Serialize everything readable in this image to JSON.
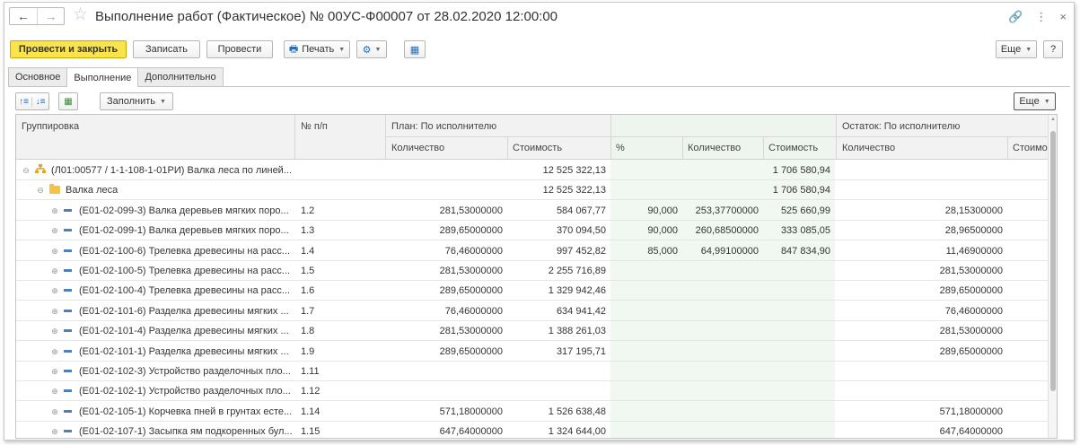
{
  "window": {
    "back": "←",
    "forward": "→",
    "title": "Выполнение работ (Фактическое) № 00УС-Ф00007 от 28.02.2020 12:00:00",
    "link_icon": "🔗",
    "more_icon": "⋮",
    "close_icon": "×"
  },
  "toolbar": {
    "post_close": "Провести и закрыть",
    "save": "Записать",
    "post": "Провести",
    "print": "Печать",
    "more": "Еще",
    "help": "?"
  },
  "tabs": [
    {
      "label": "Основное"
    },
    {
      "label": "Выполнение"
    },
    {
      "label": "Дополнительно"
    }
  ],
  "table_toolbar": {
    "fill": "Заполнить",
    "more": "Еще"
  },
  "grid": {
    "headers": {
      "group": "Группировка",
      "npp": "№ п/п",
      "plan": "План: По исполнителю",
      "rest": "Остаток: По исполнителю",
      "plan_qty": "Количество",
      "plan_cost": "Стоимость",
      "pct": "%",
      "fact_qty": "Количество",
      "fact_cost": "Стоимость",
      "rest_qty": "Количество",
      "rest_cost": "Стоимо"
    },
    "rows": [
      {
        "level": 0,
        "kind": "group",
        "exp": "⊖",
        "name": "(Л01:00577 / 1-1-108-1-01РИ) Валка леса по линей...",
        "npp": "",
        "plan_qty": "",
        "plan_cost": "12 525 322,13",
        "pct": "",
        "fact_qty": "",
        "fact_cost": "1 706 580,94",
        "rest_qty": ""
      },
      {
        "level": 1,
        "kind": "folder",
        "exp": "⊖",
        "name": "Валка леса",
        "npp": "",
        "plan_qty": "",
        "plan_cost": "12 525 322,13",
        "pct": "",
        "fact_qty": "",
        "fact_cost": "1 706 580,94",
        "rest_qty": ""
      },
      {
        "level": 2,
        "kind": "item",
        "exp": "⊕",
        "name": "(Е01-02-099-3) Валка деревьев мягких поро...",
        "npp": "1.2",
        "plan_qty": "281,53000000",
        "plan_cost": "584 067,77",
        "pct": "90,000",
        "fact_qty": "253,37700000",
        "fact_cost": "525 660,99",
        "rest_qty": "28,15300000"
      },
      {
        "level": 2,
        "kind": "item",
        "exp": "⊕",
        "name": "(Е01-02-099-1) Валка деревьев мягких поро...",
        "npp": "1.3",
        "plan_qty": "289,65000000",
        "plan_cost": "370 094,50",
        "pct": "90,000",
        "fact_qty": "260,68500000",
        "fact_cost": "333 085,05",
        "rest_qty": "28,96500000"
      },
      {
        "level": 2,
        "kind": "item",
        "exp": "⊕",
        "name": "(Е01-02-100-6) Трелевка древесины на расс...",
        "npp": "1.4",
        "plan_qty": "76,46000000",
        "plan_cost": "997 452,82",
        "pct": "85,000",
        "fact_qty": "64,99100000",
        "fact_cost": "847 834,90",
        "rest_qty": "11,46900000"
      },
      {
        "level": 2,
        "kind": "item",
        "exp": "⊕",
        "name": "(Е01-02-100-5) Трелевка древесины на расс...",
        "npp": "1.5",
        "plan_qty": "281,53000000",
        "plan_cost": "2 255 716,89",
        "pct": "",
        "fact_qty": "",
        "fact_cost": "",
        "rest_qty": "281,53000000"
      },
      {
        "level": 2,
        "kind": "item",
        "exp": "⊕",
        "name": "(Е01-02-100-4) Трелевка древесины на расс...",
        "npp": "1.6",
        "plan_qty": "289,65000000",
        "plan_cost": "1 329 942,46",
        "pct": "",
        "fact_qty": "",
        "fact_cost": "",
        "rest_qty": "289,65000000"
      },
      {
        "level": 2,
        "kind": "item",
        "exp": "⊕",
        "name": "(Е01-02-101-6) Разделка древесины мягких ...",
        "npp": "1.7",
        "plan_qty": "76,46000000",
        "plan_cost": "634 941,42",
        "pct": "",
        "fact_qty": "",
        "fact_cost": "",
        "rest_qty": "76,46000000"
      },
      {
        "level": 2,
        "kind": "item",
        "exp": "⊕",
        "name": "(Е01-02-101-4) Разделка древесины мягких ...",
        "npp": "1.8",
        "plan_qty": "281,53000000",
        "plan_cost": "1 388 261,03",
        "pct": "",
        "fact_qty": "",
        "fact_cost": "",
        "rest_qty": "281,53000000"
      },
      {
        "level": 2,
        "kind": "item",
        "exp": "⊕",
        "name": "(Е01-02-101-1) Разделка древесины мягких ...",
        "npp": "1.9",
        "plan_qty": "289,65000000",
        "plan_cost": "317 195,71",
        "pct": "",
        "fact_qty": "",
        "fact_cost": "",
        "rest_qty": "289,65000000"
      },
      {
        "level": 2,
        "kind": "item",
        "exp": "⊕",
        "name": "(Е01-02-102-3) Устройство разделочных пло...",
        "npp": "1.11",
        "plan_qty": "",
        "plan_cost": "",
        "pct": "",
        "fact_qty": "",
        "fact_cost": "",
        "rest_qty": ""
      },
      {
        "level": 2,
        "kind": "item",
        "exp": "⊕",
        "name": "(Е01-02-102-1) Устройство разделочных пло...",
        "npp": "1.12",
        "plan_qty": "",
        "plan_cost": "",
        "pct": "",
        "fact_qty": "",
        "fact_cost": "",
        "rest_qty": ""
      },
      {
        "level": 2,
        "kind": "item",
        "exp": "⊕",
        "name": "(Е01-02-105-1) Корчевка пней в грунтах есте...",
        "npp": "1.14",
        "plan_qty": "571,18000000",
        "plan_cost": "1 526 638,48",
        "pct": "",
        "fact_qty": "",
        "fact_cost": "",
        "rest_qty": "571,18000000"
      },
      {
        "level": 2,
        "kind": "item",
        "exp": "⊕",
        "name": "(Е01-02-107-1) Засыпка ям подкоренных бул...",
        "npp": "1.15",
        "plan_qty": "647,64000000",
        "plan_cost": "1 324 644,00",
        "pct": "",
        "fact_qty": "",
        "fact_cost": "",
        "rest_qty": "647,64000000"
      }
    ]
  },
  "colors": {
    "primary_button": "#fbe34b",
    "fact_column_bg": "#f1f8f1",
    "item_icon": "#4a7fc1",
    "folder_icon": "#f3c247"
  }
}
